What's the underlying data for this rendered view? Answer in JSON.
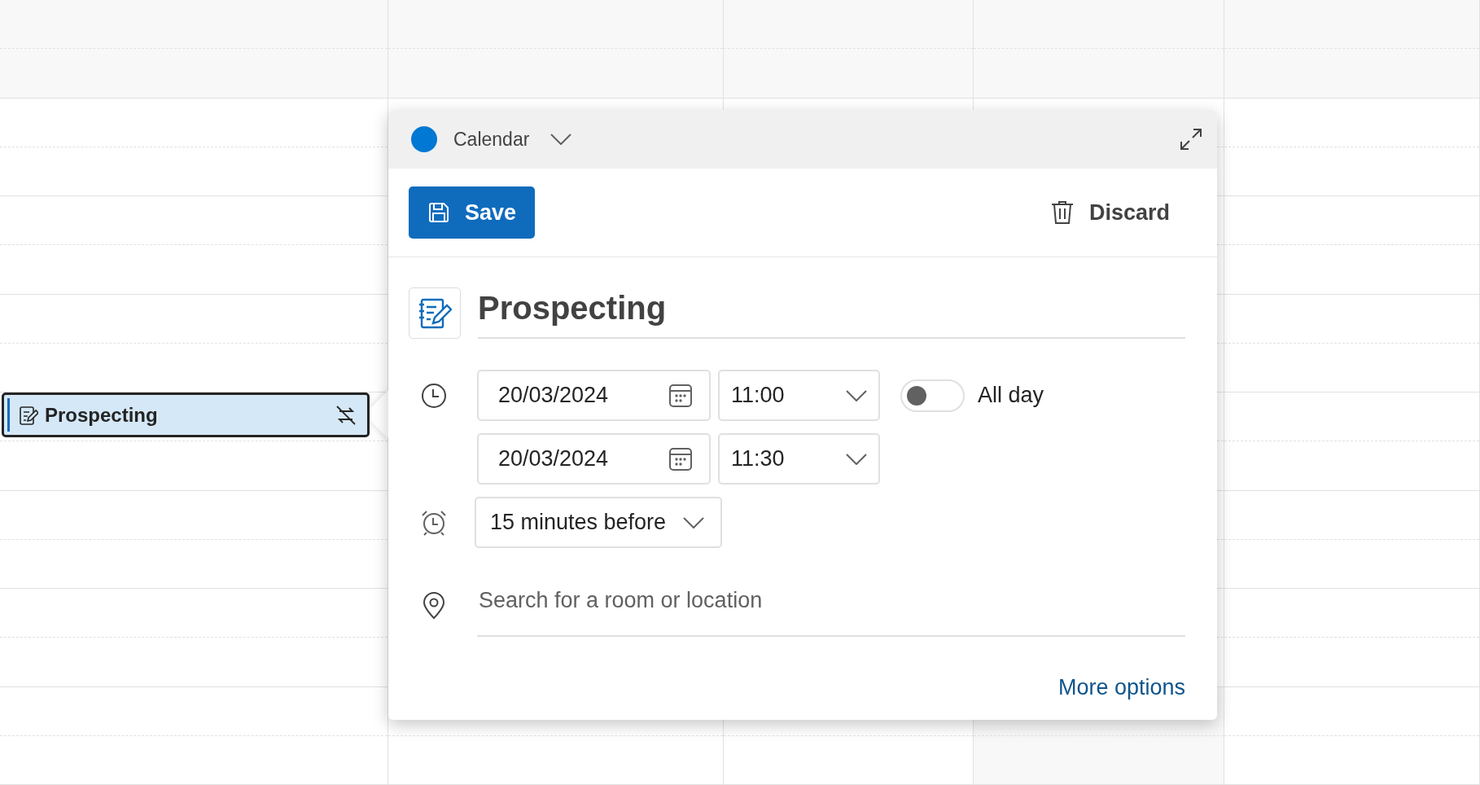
{
  "calendar_event": {
    "title": "Prospecting",
    "selected": true
  },
  "popup": {
    "calendar": {
      "name": "Calendar",
      "color": "#0078d4"
    },
    "save": "Save",
    "discard": "Discard",
    "title": "Prospecting",
    "start": {
      "date": "20/03/2024",
      "time": "11:00"
    },
    "end": {
      "date": "20/03/2024",
      "time": "11:30"
    },
    "all_day": {
      "label": "All day",
      "on": false
    },
    "reminder": "15 minutes before",
    "location": {
      "placeholder": "Search for a room or location"
    },
    "more_options": "More options"
  }
}
